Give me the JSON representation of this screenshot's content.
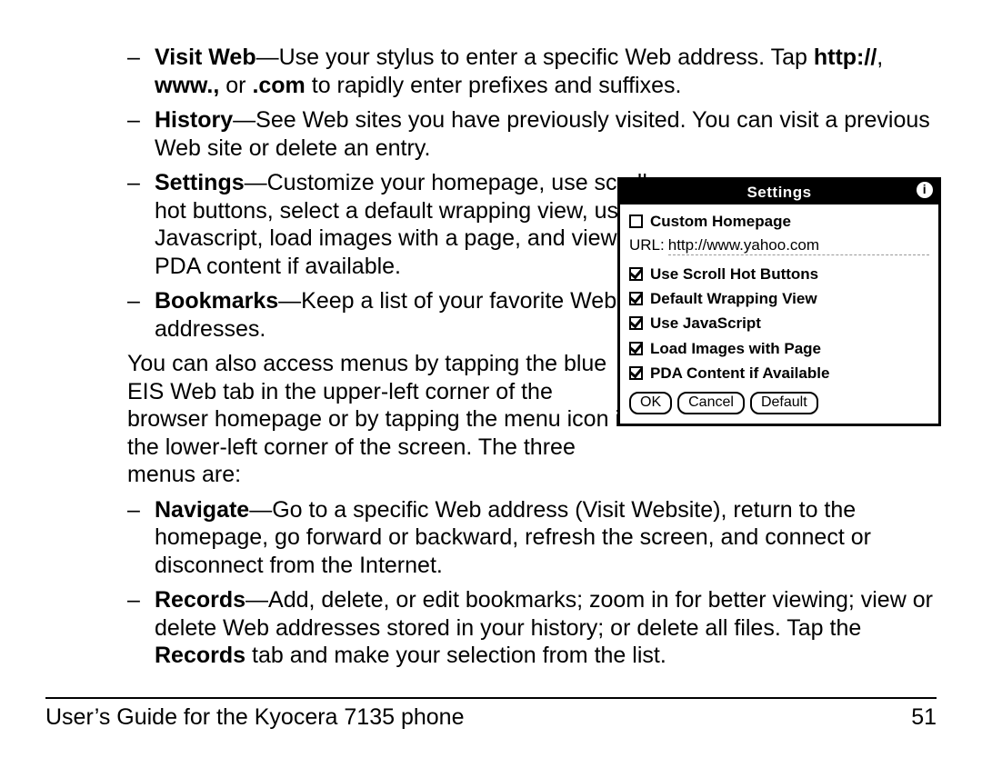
{
  "bullets": {
    "visit_web": {
      "head": "Visit Web",
      "p1": "—Use your stylus to enter a specific Web address. Tap ",
      "b1": "http://",
      "p2": ", ",
      "b2": "www.,",
      "p3": " or ",
      "b3": ".com",
      "p4": " to rapidly enter prefixes and suffixes."
    },
    "history": {
      "head": "History",
      "text": "—See Web sites you have previously visited. You can visit a previous Web site or delete an entry."
    },
    "settings": {
      "head": "Settings",
      "text": "—Customize your homepage, use scroll hot buttons, select a default wrapping view, use Javascript, load images with a page, and view PDA content if available."
    },
    "bookmarks": {
      "head": "Bookmarks",
      "text": "—Keep a list of your favorite Web addresses."
    },
    "navigate": {
      "head": "Navigate",
      "text": "—Go to a specific Web address (Visit Website), return to the homepage, go forward or backward, refresh the screen, and connect or disconnect from the Internet."
    },
    "records": {
      "head": "Records",
      "p1": "—Add, delete, or edit bookmarks; zoom in for better viewing; view or delete Web addresses stored in your history; or delete all files. Tap the ",
      "b1": "Records",
      "p2": " tab and make your selection from the list."
    }
  },
  "para_access": "You can also access menus by tapping the blue EIS Web tab in the upper-left corner of the browser homepage or by tapping the menu icon in the lower-left corner of the screen. The three menus are:",
  "footer": {
    "left": "User’s Guide for the Kyocera 7135 phone",
    "right": "51"
  },
  "pda": {
    "title": "Settings",
    "info_icon": "i",
    "custom_homepage": {
      "label": "Custom Homepage",
      "checked": false
    },
    "url_label": "URL:",
    "url_value": "http://www.yahoo.com",
    "options": [
      {
        "label": "Use Scroll Hot Buttons",
        "checked": true
      },
      {
        "label": "Default Wrapping View",
        "checked": true
      },
      {
        "label": "Use JavaScript",
        "checked": true
      },
      {
        "label": "Load Images with Page",
        "checked": true
      },
      {
        "label": "PDA Content if Available",
        "checked": true
      }
    ],
    "buttons": {
      "ok": "OK",
      "cancel": "Cancel",
      "default": "Default"
    }
  }
}
